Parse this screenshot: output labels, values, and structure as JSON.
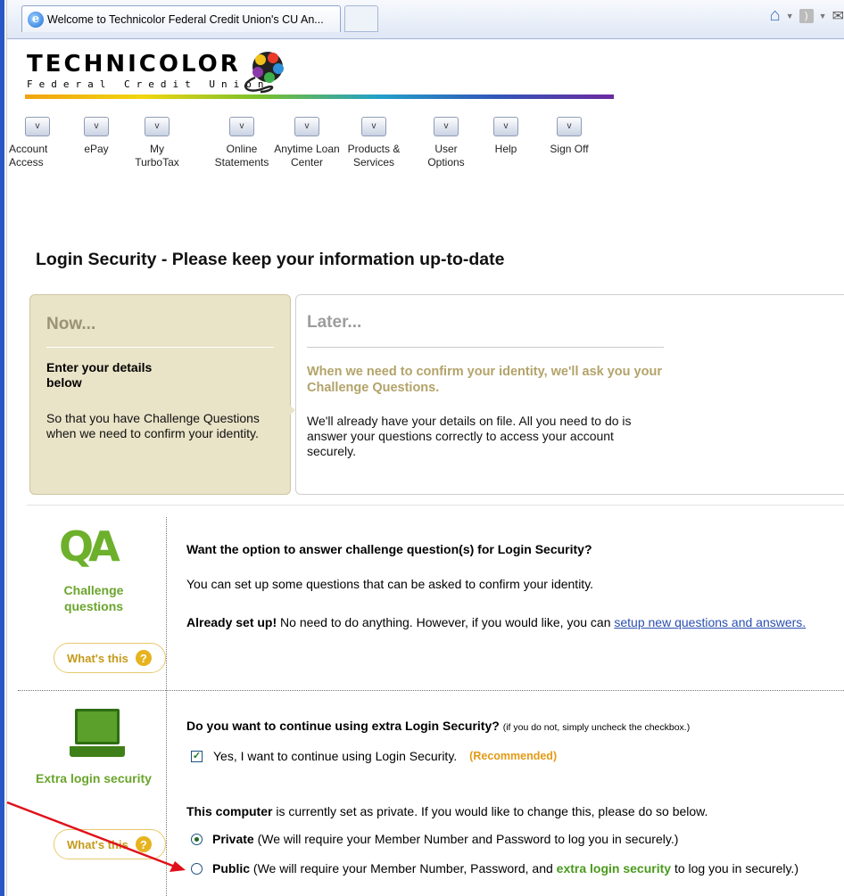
{
  "browser": {
    "tab_title": "Welcome to Technicolor Federal Credit Union's CU An..."
  },
  "logo": {
    "name": "TECHNICOLOR",
    "subtitle": "Federal Credit Union"
  },
  "nav": {
    "items": [
      {
        "label": "Account Access"
      },
      {
        "label": "ePay"
      },
      {
        "label": "My TurboTax"
      },
      {
        "label": "Online Statements"
      },
      {
        "label": "Anytime Loan Center"
      },
      {
        "label": "Products & Services"
      },
      {
        "label": "User Options"
      },
      {
        "label": "Help"
      },
      {
        "label": "Sign Off"
      }
    ]
  },
  "page": {
    "title": "Login Security - Please keep your information up-to-date"
  },
  "now": {
    "heading": "Now...",
    "subheading": "Enter your details below",
    "text": "So that you have Challenge Questions when we need to confirm your identity."
  },
  "later": {
    "heading": "Later...",
    "subheading": "When we need to confirm your identity, we'll ask you your Challenge Questions.",
    "text": "We'll already have your details on file. All you need to do is answer your questions correctly to access your account securely."
  },
  "challenge": {
    "logo_text": "QA",
    "label": "Challenge questions",
    "whats_this": "What's this",
    "question": "Want the option to answer challenge question(s) for Login Security?",
    "description": "You can set up some questions that can be asked to confirm your identity.",
    "already_bold": "Already set up!",
    "already_text": " No need to do anything. However, if you would like, you can ",
    "setup_link": "setup new questions and answers."
  },
  "extra": {
    "label": "Extra login security",
    "whats_this": "What's this",
    "question": "Do you want to continue using extra Login Security?",
    "question_note": "(if you do not, simply uncheck the checkbox.)",
    "checkbox_label": "Yes, I want to continue using Login Security.",
    "checkbox_checked": true,
    "recommended": "(Recommended)",
    "computer_bold": "This computer",
    "computer_text": " is currently set as private. If you would like to change this, please do so below.",
    "private_label": "Private",
    "private_text": " (We will require your Member Number and Password to log you in securely.)",
    "public_label": "Public",
    "public_text_1": " (We will require your Member Number, Password, and ",
    "public_highlight": "extra login security",
    "public_text_2": " to log you in securely.)",
    "selected": "Private"
  },
  "colors": {
    "accent_green": "#6db02c",
    "now_bg": "#e9e3c7",
    "arrow": "#e0101a"
  }
}
